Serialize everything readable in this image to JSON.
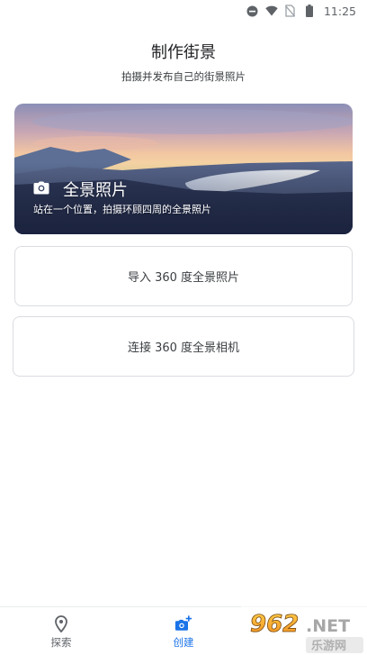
{
  "status_bar": {
    "time": "11:25",
    "icons": [
      "minus-circle-icon",
      "wifi-icon",
      "no-sim-icon",
      "battery-icon"
    ]
  },
  "header": {
    "title": "制作街景",
    "subtitle": "拍摄并发布自己的街景照片"
  },
  "hero_card": {
    "title": "全景照片",
    "description": "站在一个位置，拍摄环顾四周的全景照片",
    "icon": "camera-icon"
  },
  "options": {
    "import_label": "导入 360 度全景照片",
    "connect_label": "连接 360 度全景相机"
  },
  "bottom_nav": {
    "items": [
      {
        "label": "探索",
        "icon": "location-pin-icon",
        "active": false
      },
      {
        "label": "创建",
        "icon": "add-photo-icon",
        "active": true
      }
    ]
  },
  "watermark": {
    "text_top": "962.NET",
    "text_bottom": "乐游网"
  },
  "colors": {
    "accent": "#1a73e8",
    "text_primary": "#202124",
    "border": "#dadce0"
  }
}
